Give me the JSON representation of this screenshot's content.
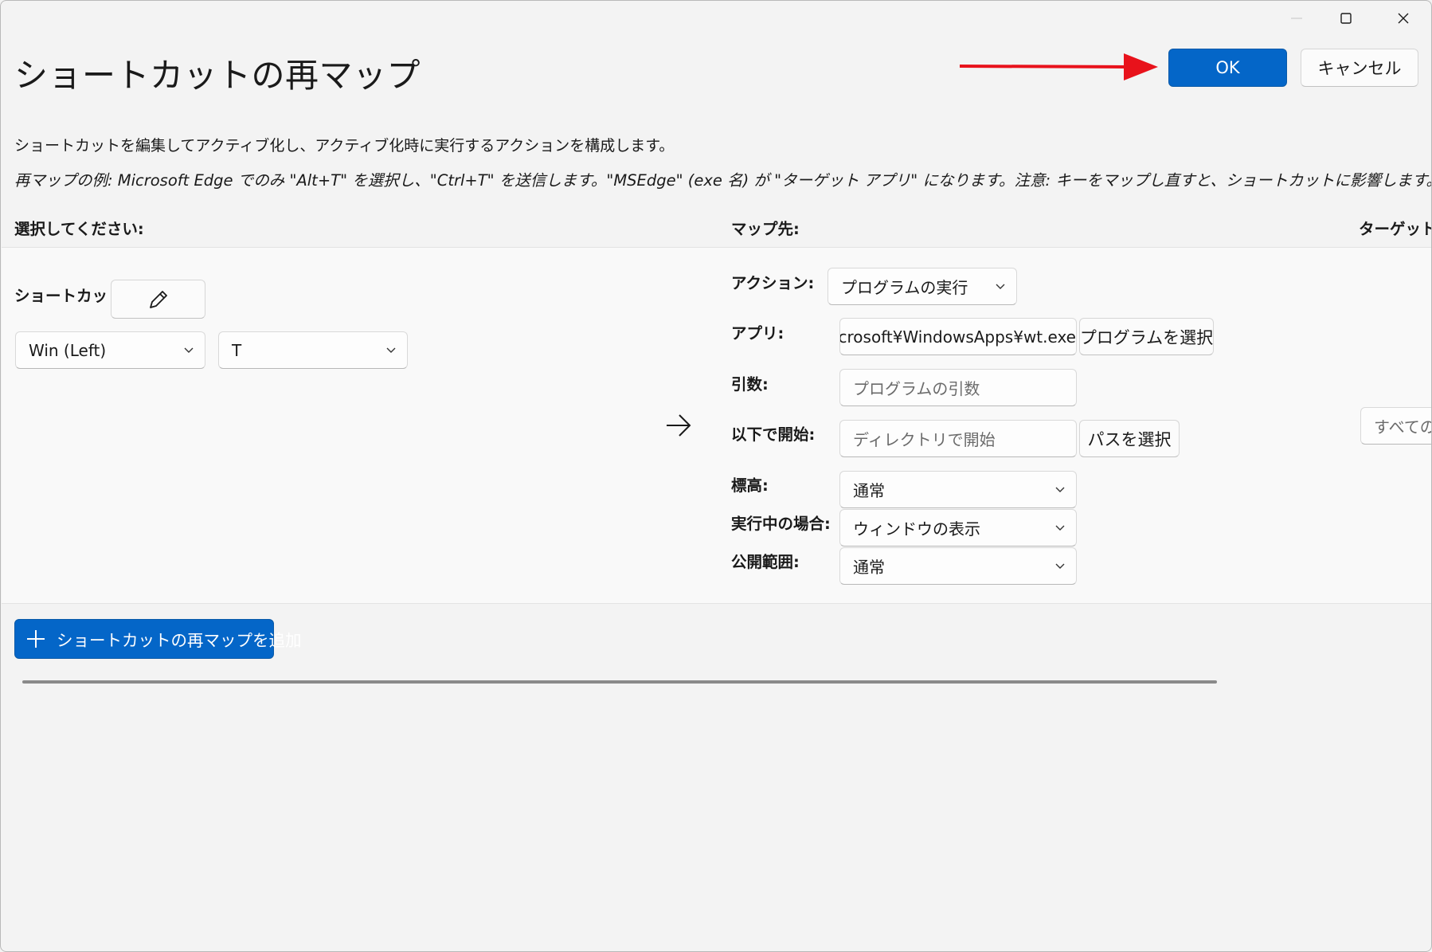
{
  "window": {
    "title": "ショートカットの再マップ",
    "ok_label": "OK",
    "cancel_label": "キャンセル"
  },
  "description": "ショートカットを編集してアクティブ化し、アクティブ化時に実行するアクションを構成します。",
  "example": "再マップの例: Microsoft Edge でのみ \"Alt+T\" を選択し、\"Ctrl+T\" を送信します。\"MSEdge\" (exe 名) が \"ターゲット アプリ\" になります。注意: キーをマップし直すと、ショートカットに影響します。",
  "columns": {
    "select": "選択してください:",
    "map_to": "マップ先:",
    "target_app": "ターゲット ア"
  },
  "row": {
    "shortcut_label": "ショートカット:",
    "key1": "Win (Left)",
    "key2": "T",
    "arrow": "→",
    "action_label": "アクション:",
    "action_value": "プログラムの実行",
    "app_label": "アプリ:",
    "app_value": "crosoft¥WindowsApps¥wt.exe",
    "select_program_label": "プログラムを選択",
    "args_label": "引数:",
    "args_placeholder": "プログラムの引数",
    "start_in_label": "以下で開始:",
    "start_in_placeholder": "ディレクトリで開始",
    "select_path_label": "パスを選択",
    "elevation_label": "標高:",
    "elevation_value": "通常",
    "if_running_label": "実行中の場合:",
    "if_running_value": "ウィンドウの表示",
    "visibility_label": "公開範囲:",
    "visibility_value": "通常",
    "target_app_value": "すべての ア"
  },
  "add_button_label": "ショートカットの再マップを追加",
  "colors": {
    "accent": "#0466c8",
    "annotation_arrow": "#e8121b"
  }
}
